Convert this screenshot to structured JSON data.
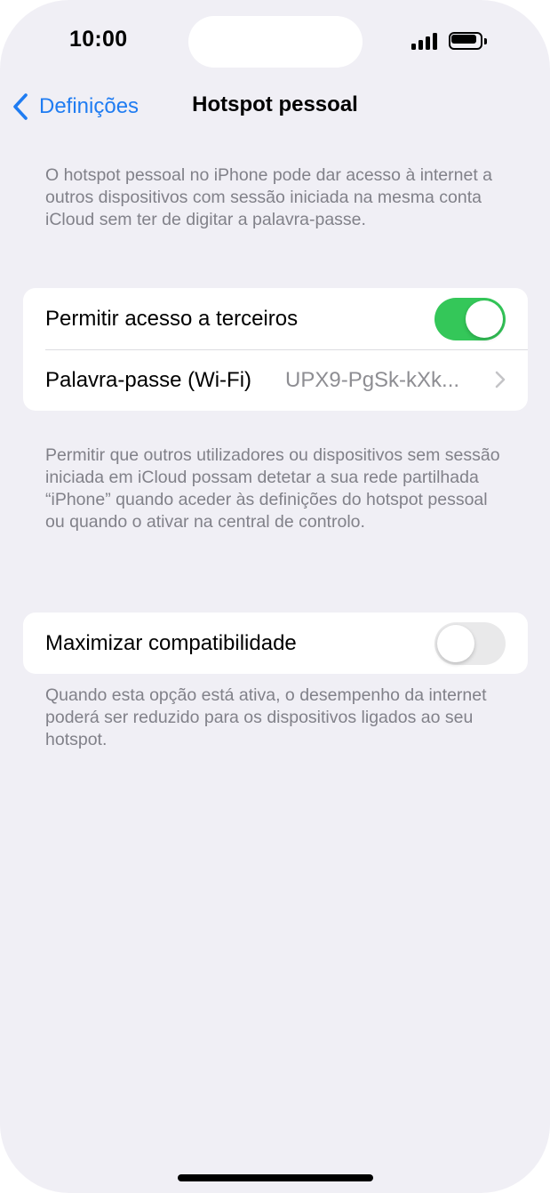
{
  "status_bar": {
    "time": "10:00"
  },
  "nav": {
    "back_label": "Definições",
    "title": "Hotspot pessoal"
  },
  "intro_text": "O hotspot pessoal no iPhone pode dar acesso à internet a outros dispositivos com sessão iniciada na mesma conta iCloud sem ter de digitar a palavra-passe.",
  "group1": {
    "allow_access": {
      "label": "Permitir acesso a terceiros",
      "enabled": true
    },
    "password": {
      "label": "Palavra-passe (Wi-Fi)",
      "value": "UPX9-PgSk-kXk..."
    }
  },
  "group1_footer": "Permitir que outros utilizadores ou dispositivos sem sessão iniciada em iCloud possam detetar a sua rede partilhada “iPhone” quando aceder às definições do hotspot pessoal ou quando o ativar na central de controlo.",
  "group2": {
    "maximize_compat": {
      "label": "Maximizar compatibilidade",
      "enabled": false
    }
  },
  "group2_footer": "Quando esta opção está ativa, o desempenho da internet poderá ser reduzido para os dispositivos ligados ao seu hotspot.",
  "colors": {
    "accent": "#1f7cf2",
    "toggle_on": "#34c759",
    "background": "#f0eff5"
  },
  "icons": [
    "chevron-left-icon",
    "chevron-right-icon",
    "signal-icon",
    "battery-icon"
  ]
}
